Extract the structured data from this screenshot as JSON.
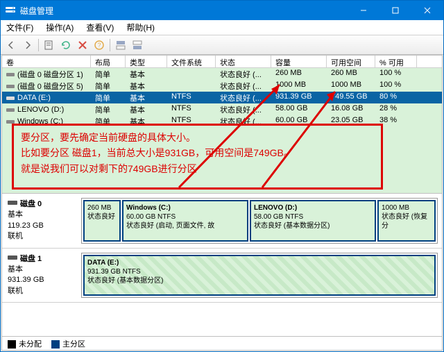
{
  "window": {
    "title": "磁盘管理",
    "winbtn_min": "minimize",
    "winbtn_max": "maximize",
    "winbtn_close": "close"
  },
  "menubar": {
    "file": "文件(F)",
    "action": "操作(A)",
    "view": "查看(V)",
    "help": "帮助(H)"
  },
  "columns": {
    "volume": "卷",
    "layout": "布局",
    "type": "类型",
    "fs": "文件系统",
    "status": "状态",
    "capacity": "容量",
    "free": "可用空间",
    "pct": "% 可用"
  },
  "volumes": {
    "0": {
      "name": "(磁盘 0 磁盘分区 1)",
      "layout": "简单",
      "type": "基本",
      "fs": "",
      "status": "状态良好 (...",
      "cap": "260 MB",
      "free": "260 MB",
      "pct": "100 %"
    },
    "1": {
      "name": "(磁盘 0 磁盘分区 5)",
      "layout": "简单",
      "type": "基本",
      "fs": "",
      "status": "状态良好 (...",
      "cap": "1000 MB",
      "free": "1000 MB",
      "pct": "100 %"
    },
    "2": {
      "name": "DATA (E:)",
      "layout": "简单",
      "type": "基本",
      "fs": "NTFS",
      "status": "状态良好 (...",
      "cap": "931.39 GB",
      "free": "749.55 GB",
      "pct": "80 %"
    },
    "3": {
      "name": "LENOVO (D:)",
      "layout": "简单",
      "type": "基本",
      "fs": "NTFS",
      "status": "状态良好 (...",
      "cap": "58.00 GB",
      "free": "16.08 GB",
      "pct": "28 %"
    },
    "4": {
      "name": "Windows (C:)",
      "layout": "简单",
      "type": "基本",
      "fs": "NTFS",
      "status": "状态良好 (...",
      "cap": "60.00 GB",
      "free": "23.05 GB",
      "pct": "38 %"
    }
  },
  "annotation": {
    "line1": "要分区，要先确定当前硬盘的具体大小。",
    "line2": "比如要分区 磁盘1，当前总大小是931GB，可用空间是749GB。",
    "line3": "就是说我们可以对剩下的749GB进行分区"
  },
  "disk0": {
    "title": "磁盘 0",
    "type": "基本",
    "size": "119.23 GB",
    "status": "联机",
    "p0": {
      "name": "",
      "size": "260 MB",
      "status": "状态良好"
    },
    "p1": {
      "name": "Windows  (C:)",
      "size": "60.00 GB NTFS",
      "status": "状态良好 (启动, 页面文件, 故"
    },
    "p2": {
      "name": "LENOVO  (D:)",
      "size": "58.00 GB NTFS",
      "status": "状态良好 (基本数据分区)"
    },
    "p3": {
      "name": "",
      "size": "1000 MB",
      "status": "状态良好 (恢复分"
    }
  },
  "disk1": {
    "title": "磁盘 1",
    "type": "基本",
    "size": "931.39 GB",
    "status": "联机",
    "p0": {
      "name": "DATA  (E:)",
      "size": "931.39 GB NTFS",
      "status": "状态良好 (基本数据分区)"
    }
  },
  "legend": {
    "unallocated": "未分配",
    "primary": "主分区"
  }
}
